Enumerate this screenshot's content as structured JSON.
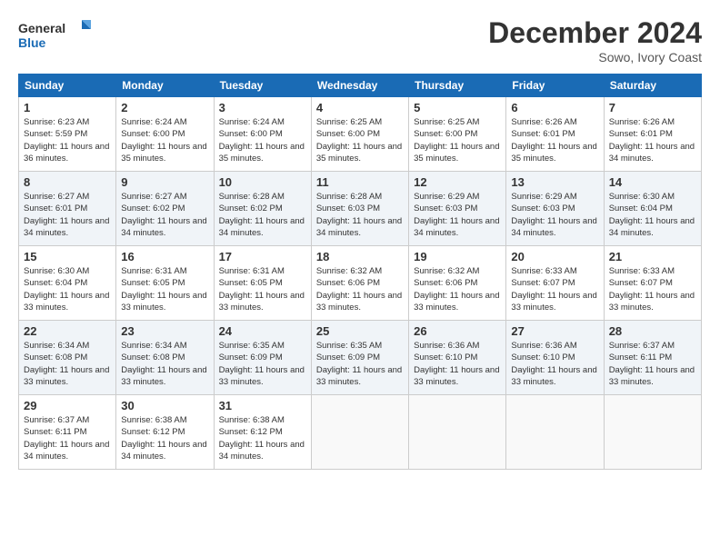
{
  "logo": {
    "line1": "General",
    "line2": "Blue"
  },
  "title": "December 2024",
  "location": "Sowo, Ivory Coast",
  "days_of_week": [
    "Sunday",
    "Monday",
    "Tuesday",
    "Wednesday",
    "Thursday",
    "Friday",
    "Saturday"
  ],
  "weeks": [
    [
      {
        "day": "1",
        "sunrise": "6:23 AM",
        "sunset": "5:59 PM",
        "daylight": "11 hours and 36 minutes."
      },
      {
        "day": "2",
        "sunrise": "6:24 AM",
        "sunset": "6:00 PM",
        "daylight": "11 hours and 35 minutes."
      },
      {
        "day": "3",
        "sunrise": "6:24 AM",
        "sunset": "6:00 PM",
        "daylight": "11 hours and 35 minutes."
      },
      {
        "day": "4",
        "sunrise": "6:25 AM",
        "sunset": "6:00 PM",
        "daylight": "11 hours and 35 minutes."
      },
      {
        "day": "5",
        "sunrise": "6:25 AM",
        "sunset": "6:00 PM",
        "daylight": "11 hours and 35 minutes."
      },
      {
        "day": "6",
        "sunrise": "6:26 AM",
        "sunset": "6:01 PM",
        "daylight": "11 hours and 35 minutes."
      },
      {
        "day": "7",
        "sunrise": "6:26 AM",
        "sunset": "6:01 PM",
        "daylight": "11 hours and 34 minutes."
      }
    ],
    [
      {
        "day": "8",
        "sunrise": "6:27 AM",
        "sunset": "6:01 PM",
        "daylight": "11 hours and 34 minutes."
      },
      {
        "day": "9",
        "sunrise": "6:27 AM",
        "sunset": "6:02 PM",
        "daylight": "11 hours and 34 minutes."
      },
      {
        "day": "10",
        "sunrise": "6:28 AM",
        "sunset": "6:02 PM",
        "daylight": "11 hours and 34 minutes."
      },
      {
        "day": "11",
        "sunrise": "6:28 AM",
        "sunset": "6:03 PM",
        "daylight": "11 hours and 34 minutes."
      },
      {
        "day": "12",
        "sunrise": "6:29 AM",
        "sunset": "6:03 PM",
        "daylight": "11 hours and 34 minutes."
      },
      {
        "day": "13",
        "sunrise": "6:29 AM",
        "sunset": "6:03 PM",
        "daylight": "11 hours and 34 minutes."
      },
      {
        "day": "14",
        "sunrise": "6:30 AM",
        "sunset": "6:04 PM",
        "daylight": "11 hours and 34 minutes."
      }
    ],
    [
      {
        "day": "15",
        "sunrise": "6:30 AM",
        "sunset": "6:04 PM",
        "daylight": "11 hours and 33 minutes."
      },
      {
        "day": "16",
        "sunrise": "6:31 AM",
        "sunset": "6:05 PM",
        "daylight": "11 hours and 33 minutes."
      },
      {
        "day": "17",
        "sunrise": "6:31 AM",
        "sunset": "6:05 PM",
        "daylight": "11 hours and 33 minutes."
      },
      {
        "day": "18",
        "sunrise": "6:32 AM",
        "sunset": "6:06 PM",
        "daylight": "11 hours and 33 minutes."
      },
      {
        "day": "19",
        "sunrise": "6:32 AM",
        "sunset": "6:06 PM",
        "daylight": "11 hours and 33 minutes."
      },
      {
        "day": "20",
        "sunrise": "6:33 AM",
        "sunset": "6:07 PM",
        "daylight": "11 hours and 33 minutes."
      },
      {
        "day": "21",
        "sunrise": "6:33 AM",
        "sunset": "6:07 PM",
        "daylight": "11 hours and 33 minutes."
      }
    ],
    [
      {
        "day": "22",
        "sunrise": "6:34 AM",
        "sunset": "6:08 PM",
        "daylight": "11 hours and 33 minutes."
      },
      {
        "day": "23",
        "sunrise": "6:34 AM",
        "sunset": "6:08 PM",
        "daylight": "11 hours and 33 minutes."
      },
      {
        "day": "24",
        "sunrise": "6:35 AM",
        "sunset": "6:09 PM",
        "daylight": "11 hours and 33 minutes."
      },
      {
        "day": "25",
        "sunrise": "6:35 AM",
        "sunset": "6:09 PM",
        "daylight": "11 hours and 33 minutes."
      },
      {
        "day": "26",
        "sunrise": "6:36 AM",
        "sunset": "6:10 PM",
        "daylight": "11 hours and 33 minutes."
      },
      {
        "day": "27",
        "sunrise": "6:36 AM",
        "sunset": "6:10 PM",
        "daylight": "11 hours and 33 minutes."
      },
      {
        "day": "28",
        "sunrise": "6:37 AM",
        "sunset": "6:11 PM",
        "daylight": "11 hours and 33 minutes."
      }
    ],
    [
      {
        "day": "29",
        "sunrise": "6:37 AM",
        "sunset": "6:11 PM",
        "daylight": "11 hours and 34 minutes."
      },
      {
        "day": "30",
        "sunrise": "6:38 AM",
        "sunset": "6:12 PM",
        "daylight": "11 hours and 34 minutes."
      },
      {
        "day": "31",
        "sunrise": "6:38 AM",
        "sunset": "6:12 PM",
        "daylight": "11 hours and 34 minutes."
      },
      null,
      null,
      null,
      null
    ]
  ]
}
